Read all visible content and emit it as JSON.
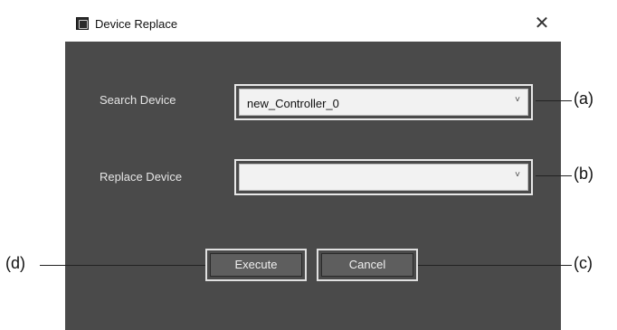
{
  "dialog": {
    "title": "Device Replace",
    "close_glyph": "✕"
  },
  "search": {
    "label": "Search Device",
    "value": "new_Controller_0",
    "arrow_glyph": "˅"
  },
  "replace": {
    "label": "Replace Device",
    "value": "",
    "arrow_glyph": "˅"
  },
  "buttons": {
    "execute": "Execute",
    "cancel": "Cancel"
  },
  "callouts": {
    "a": "(a)",
    "b": "(b)",
    "c": "(c)",
    "d": "(d)"
  },
  "colors": {
    "dialog_bg": "#4a4a4a",
    "titlebar_bg": "#ffffff",
    "label_text": "#e6e6e6"
  }
}
